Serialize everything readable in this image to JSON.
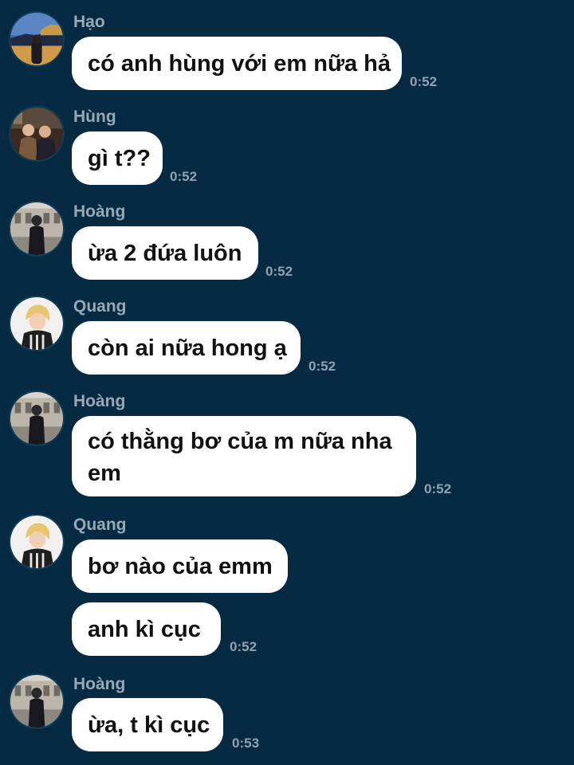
{
  "colors": {
    "background": "#052a41",
    "bubble": "#ffffff",
    "sender_name": "#97a9b6",
    "timestamp": "#8fa3b2"
  },
  "messages": [
    {
      "sender": "Hạo",
      "text": "có anh hùng với em nữa hả",
      "time": "0:52",
      "avatar_icon": "city-night-avatar-icon"
    },
    {
      "sender": "Hùng",
      "text": "gì t??",
      "time": "0:52",
      "avatar_icon": "group-photo-avatar-icon"
    },
    {
      "sender": "Hoàng",
      "text": "ừa 2 đứa luôn",
      "time": "0:52",
      "avatar_icon": "building-portrait-avatar-icon"
    },
    {
      "sender": "Quang",
      "text": "còn ai nữa hong ạ",
      "time": "0:52",
      "avatar_icon": "blond-portrait-avatar-icon"
    },
    {
      "sender": "Hoàng",
      "text": "có thằng bơ của m nữa nha em",
      "time": "0:52",
      "avatar_icon": "building-portrait-avatar-icon"
    },
    {
      "sender": "Quang",
      "text": "bơ nào của emm",
      "time": "",
      "avatar_icon": "blond-portrait-avatar-icon"
    },
    {
      "sender": "",
      "text": "anh kì cục",
      "time": "0:52",
      "avatar_icon": ""
    },
    {
      "sender": "Hoàng",
      "text": "ừa, t kì cục",
      "time": "0:53",
      "avatar_icon": "building-portrait-avatar-icon"
    }
  ]
}
